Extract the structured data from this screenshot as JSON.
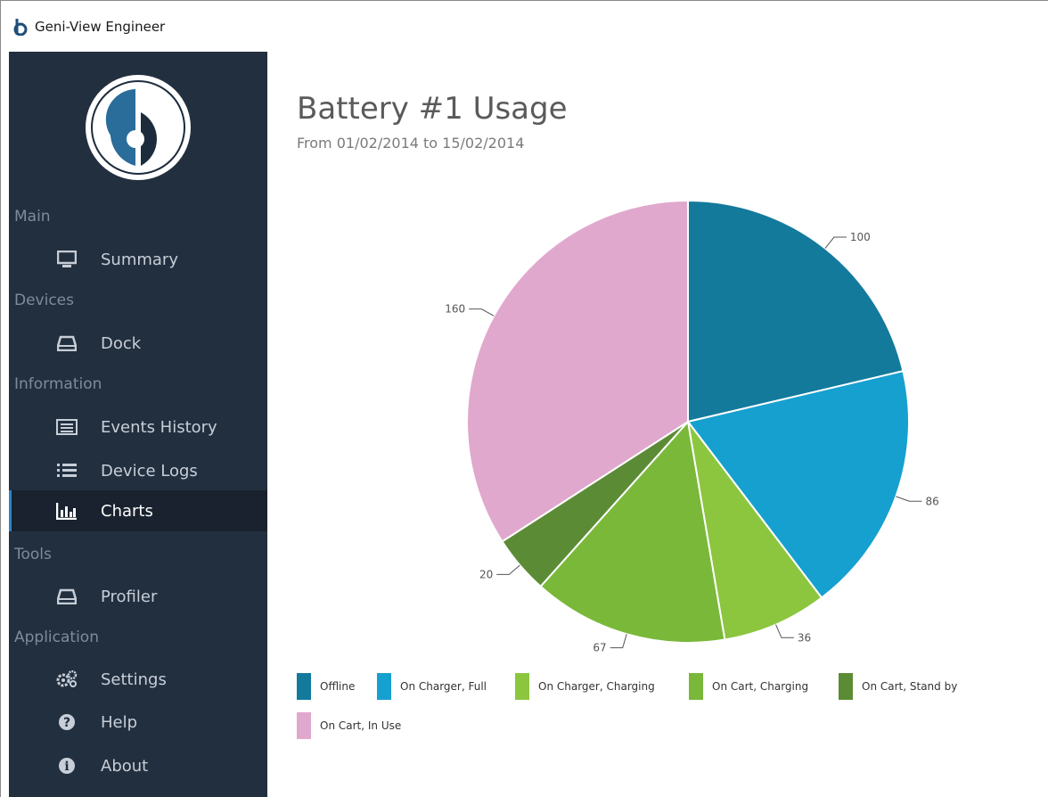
{
  "window": {
    "title": "Geni-View Engineer"
  },
  "sidebar": {
    "sections": [
      {
        "label": "Main",
        "items": [
          {
            "label": "Summary",
            "icon": "monitor-icon"
          }
        ]
      },
      {
        "label": "Devices",
        "items": [
          {
            "label": "Dock",
            "icon": "drive-icon"
          }
        ]
      },
      {
        "label": "Information",
        "items": [
          {
            "label": "Events History",
            "icon": "list-box-icon"
          },
          {
            "label": "Device Logs",
            "icon": "list-icon"
          },
          {
            "label": "Charts",
            "icon": "bar-chart-icon",
            "active": true
          }
        ]
      },
      {
        "label": "Tools",
        "items": [
          {
            "label": "Profiler",
            "icon": "drive-icon"
          }
        ]
      },
      {
        "label": "Application",
        "items": [
          {
            "label": "Settings",
            "icon": "gears-icon"
          },
          {
            "label": "Help",
            "icon": "question-icon"
          },
          {
            "label": "About",
            "icon": "info-icon"
          }
        ]
      }
    ]
  },
  "page": {
    "title": "Battery #1 Usage",
    "subtitle": "From 01/02/2014 to 15/02/2014"
  },
  "chart_data": {
    "type": "pie",
    "categories": [
      "Offline",
      "On Charger, Full",
      "On Charger, Charging",
      "On Cart, Charging",
      "On Cart, Stand by",
      "On Cart, In Use"
    ],
    "values": [
      100,
      86,
      36,
      67,
      20,
      160
    ],
    "colors": [
      "#137a9c",
      "#16a0cf",
      "#8cc63f",
      "#7ab83a",
      "#5b8c35",
      "#e0a8cd"
    ],
    "legend_position": "bottom-left"
  }
}
